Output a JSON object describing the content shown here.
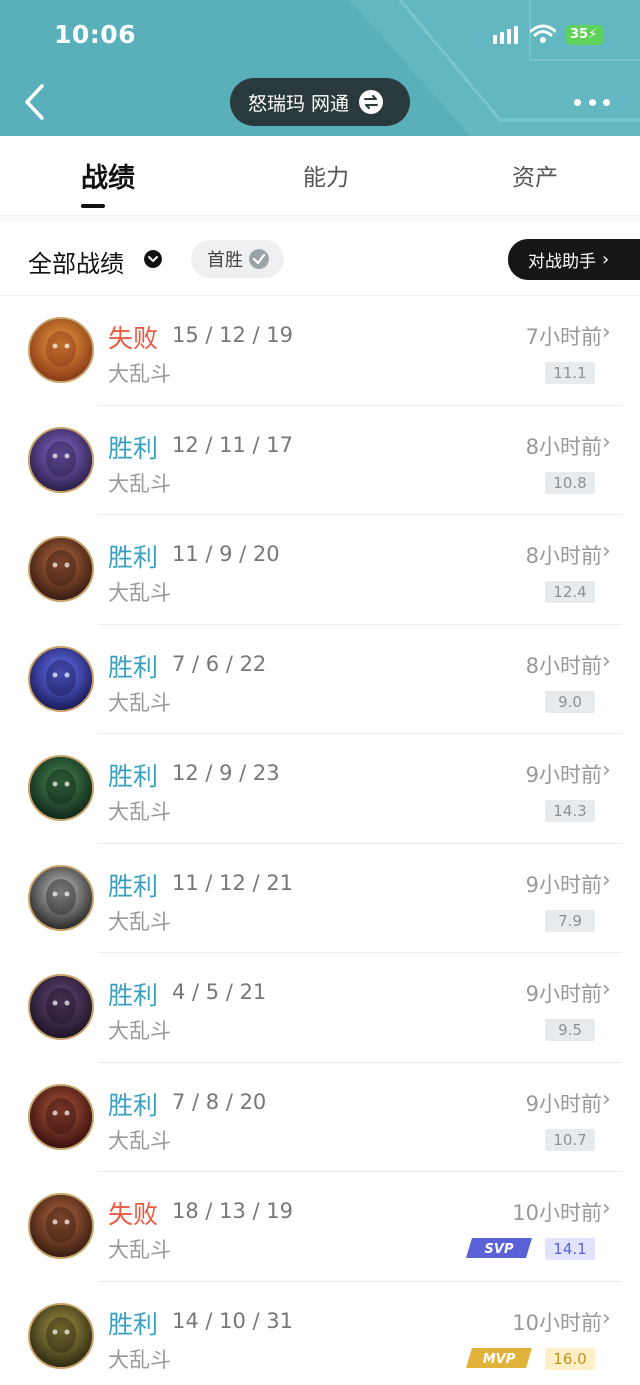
{
  "status_bar": {
    "time": "10:06",
    "battery": "35"
  },
  "header": {
    "account": "怒瑞玛 网通"
  },
  "tabs": [
    {
      "label": "战绩",
      "active": true
    },
    {
      "label": "能力",
      "active": false
    },
    {
      "label": "资产",
      "active": false
    }
  ],
  "filter": {
    "all_label": "全部战绩",
    "chip_label": "首胜",
    "assistant_label": "对战助手"
  },
  "colors": {
    "header": "#5ab0ba",
    "win": "#3aa0c2",
    "loss": "#ea5a40"
  },
  "matches": [
    {
      "result": "失败",
      "kda": "15 / 12 / 19",
      "mode": "大乱斗",
      "time": "7小时前",
      "score": "11.1",
      "badge": ""
    },
    {
      "result": "胜利",
      "kda": "12 / 11 / 17",
      "mode": "大乱斗",
      "time": "8小时前",
      "score": "10.8",
      "badge": ""
    },
    {
      "result": "胜利",
      "kda": "11 / 9 / 20",
      "mode": "大乱斗",
      "time": "8小时前",
      "score": "12.4",
      "badge": ""
    },
    {
      "result": "胜利",
      "kda": "7 / 6 / 22",
      "mode": "大乱斗",
      "time": "8小时前",
      "score": "9.0",
      "badge": ""
    },
    {
      "result": "胜利",
      "kda": "12 / 9 / 23",
      "mode": "大乱斗",
      "time": "9小时前",
      "score": "14.3",
      "badge": ""
    },
    {
      "result": "胜利",
      "kda": "11 / 12 / 21",
      "mode": "大乱斗",
      "time": "9小时前",
      "score": "7.9",
      "badge": ""
    },
    {
      "result": "胜利",
      "kda": "4 / 5 / 21",
      "mode": "大乱斗",
      "time": "9小时前",
      "score": "9.5",
      "badge": ""
    },
    {
      "result": "胜利",
      "kda": "7 / 8 / 20",
      "mode": "大乱斗",
      "time": "9小时前",
      "score": "10.7",
      "badge": ""
    },
    {
      "result": "失败",
      "kda": "18 / 13 / 19",
      "mode": "大乱斗",
      "time": "10小时前",
      "score": "14.1",
      "badge": "SVP"
    },
    {
      "result": "胜利",
      "kda": "14 / 10 / 31",
      "mode": "大乱斗",
      "time": "10小时前",
      "score": "16.0",
      "badge": "MVP"
    }
  ]
}
